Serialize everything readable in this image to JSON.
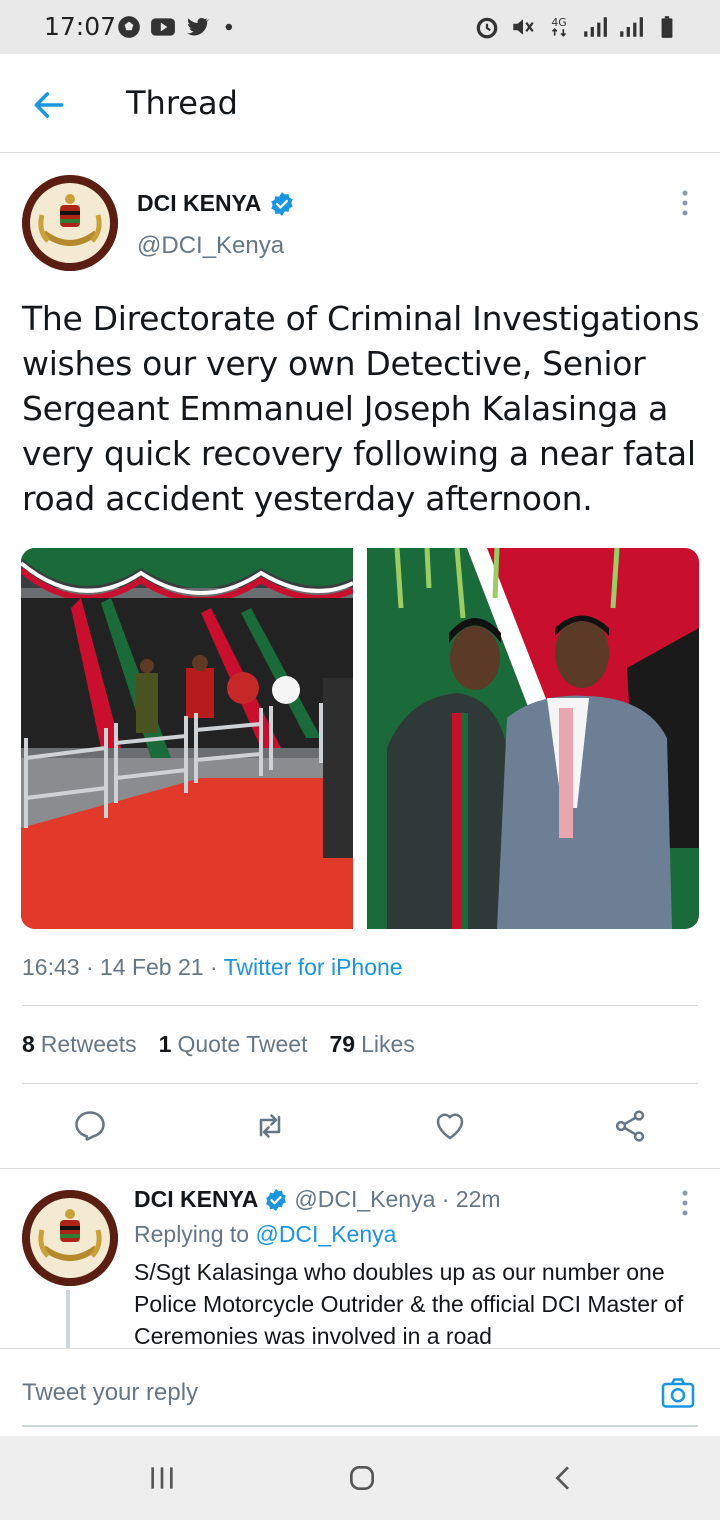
{
  "status_bar": {
    "time": "17:07",
    "icons_left": [
      "soccer-ball-icon",
      "youtube-icon",
      "twitter-icon",
      "dot-icon"
    ],
    "icons_right": [
      "alarm-icon",
      "mute-icon",
      "4g-icon",
      "signal-icon",
      "signal-icon",
      "battery-icon"
    ],
    "network": "4G"
  },
  "header": {
    "title": "Thread"
  },
  "tweet": {
    "author_name": "DCI KENYA",
    "author_handle": "@DCI_Kenya",
    "verified": true,
    "text": "The Directorate of Criminal Investigations wishes our very own Detective, Senior Sergeant Emmanuel Joseph Kalasinga a very quick recovery following a near fatal road accident yesterday afternoon.",
    "timestamp": "16:43 · 14 Feb 21 · ",
    "source": "Twitter for iPhone",
    "stats": {
      "retweets_count": "8",
      "retweets_label": "Retweets",
      "quotes_count": "1",
      "quotes_label": "Quote Tweet",
      "likes_count": "79",
      "likes_label": "Likes"
    },
    "actions": [
      "reply-icon",
      "retweet-icon",
      "like-icon",
      "share-icon"
    ]
  },
  "reply": {
    "author_name": "DCI KENYA",
    "author_handle": "@DCI_Kenya · 22m",
    "replying_prefix": "Replying to ",
    "replying_to": "@DCI_Kenya",
    "text": "S/Sgt Kalasinga who doubles up as our number one Police Motorcycle Outrider & the official DCI Master of Ceremonies was involved in a road"
  },
  "reply_bar": {
    "placeholder": "Tweet your reply"
  },
  "colors": {
    "accent": "#1b95e0",
    "text": "#14171a",
    "secondary": "#657786",
    "divider": "#d9dde0"
  }
}
